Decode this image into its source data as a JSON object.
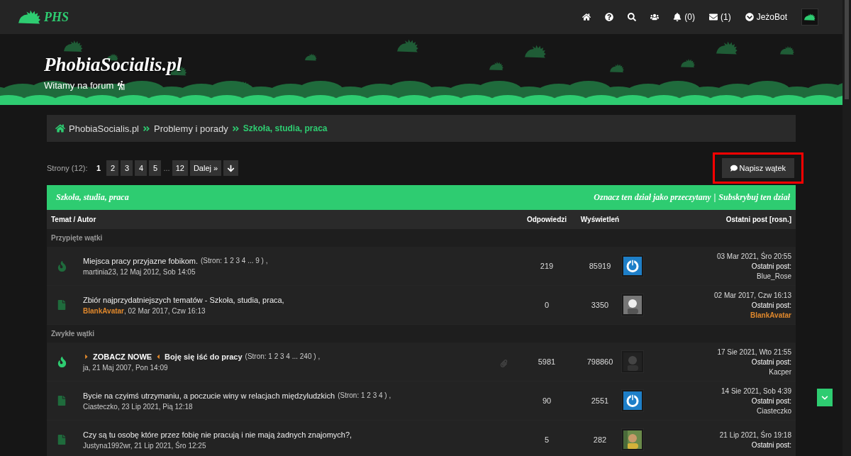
{
  "logo": {
    "text": "PHS"
  },
  "nav": [
    {
      "kind": "home"
    },
    {
      "kind": "help"
    },
    {
      "kind": "search"
    },
    {
      "kind": "users"
    },
    {
      "kind": "bell",
      "count": "(0)"
    },
    {
      "kind": "mail",
      "count": "(1)"
    },
    {
      "kind": "user",
      "label": "JeżoBot"
    }
  ],
  "banner": {
    "title": "PhobiaSocialis.pl",
    "subtitle": "Witamy na forum"
  },
  "breadcrumb": [
    {
      "label": "PhobiaSocialis.pl",
      "current": false
    },
    {
      "label": "Problemy i porady",
      "current": false
    },
    {
      "label": "Szkoła, studia, praca",
      "current": true
    }
  ],
  "pagination": {
    "label": "Strony (12):",
    "items": [
      {
        "kind": "page",
        "label": "1",
        "selected": true
      },
      {
        "kind": "page",
        "label": "2",
        "selected": false
      },
      {
        "kind": "page",
        "label": "3",
        "selected": false
      },
      {
        "kind": "page",
        "label": "4",
        "selected": false
      },
      {
        "kind": "page",
        "label": "5",
        "selected": false
      },
      {
        "kind": "ellipsis",
        "label": "..."
      },
      {
        "kind": "page",
        "label": "12",
        "selected": false
      },
      {
        "kind": "page",
        "label": "Dalej »",
        "selected": false
      },
      {
        "kind": "jump"
      }
    ]
  },
  "new_thread_button": {
    "label": "Napisz wątek",
    "highlighted": true
  },
  "forum": {
    "title": "Szkoła, studia, praca",
    "actions": [
      "Oznacz ten dział jako przeczytany",
      "Subskrybuj ten dział"
    ],
    "action_separator": "|",
    "columns": [
      "Temat / Autor",
      "Odpowiedzi",
      "Wyświetleń",
      "Ostatni post [rosn.]"
    ],
    "sections": [
      {
        "title": "Przypięte wątki",
        "threads": [
          {
            "kind": "hot",
            "unread": false,
            "title": "Miejsca pracy przyjazne fobikom.",
            "pages": "(Stron: 1 2 3 4 ... 9 ) ,",
            "author": {
              "name": "martinia23"
            },
            "date": ", 12 Maj 2012, Sob 14:05",
            "attachment": false,
            "replies": "219",
            "views": "85919",
            "avatar": {
              "kind": "power"
            },
            "last_date": "03 Mar 2021, Śro 20:55",
            "last_label": "Ostatni post:",
            "last_author": {
              "name": "Blue_Rose"
            }
          },
          {
            "kind": "normal",
            "unread": false,
            "title": "Zbiór najprzydatniejszych tematów - Szkoła, studia, praca,",
            "author": {
              "name": "BlankAvatar",
              "color": "#e0882c"
            },
            "date": ", 02 Mar 2017, Czw 16:13",
            "attachment": false,
            "replies": "0",
            "views": "3350",
            "last_date": "02 Mar 2017, Czw 16:13",
            "last_label": "Ostatni post:",
            "last_author": {
              "name": "BlankAvatar",
              "color": "#e0882c"
            }
          }
        ]
      },
      {
        "title": "Zwykłe wątki",
        "threads": [
          {
            "kind": "hot",
            "unread": true,
            "new_label": "ZOBACZ NOWE",
            "title": "Boję się iść do pracy",
            "pages": "(Stron: 1 2 3 4 ... 240 ) ,",
            "author": {
              "name": "ja"
            },
            "date": ", 21 Maj 2007, Pon 14:09",
            "attachment": true,
            "replies": "5981",
            "views": "798860",
            "last_date": "17 Sie 2021, Wto 21:55",
            "last_label": "Ostatni post:",
            "last_author": {
              "name": "Kacper"
            }
          },
          {
            "kind": "normal",
            "unread": false,
            "title": "Bycie na czyimś utrzymaniu, a poczucie winy w relacjach międzyludzkich",
            "pages": "(Stron: 1 2 3 4 ) ,",
            "author": {
              "name": "Ciasteczko"
            },
            "date": ", 23 Lip 2021, Pią 12:18",
            "attachment": false,
            "replies": "90",
            "views": "2551",
            "avatar": {
              "kind": "power"
            },
            "last_date": "14 Sie 2021, Sob 4:39",
            "last_label": "Ostatni post:",
            "last_author": {
              "name": "Ciasteczko"
            }
          },
          {
            "kind": "normal",
            "unread": false,
            "title": "Czy są tu osobę które przez fobię nie pracują i nie mają żadnych znajomych?,",
            "author": {
              "name": "Justyna1992wr"
            },
            "date": ", 21 Lip 2021, Śro 12:25",
            "attachment": false,
            "replies": "5",
            "views": "282",
            "last_date": "21 Lip 2021, Śro 19:18",
            "last_label": "Ostatni post:"
          }
        ]
      }
    ]
  }
}
